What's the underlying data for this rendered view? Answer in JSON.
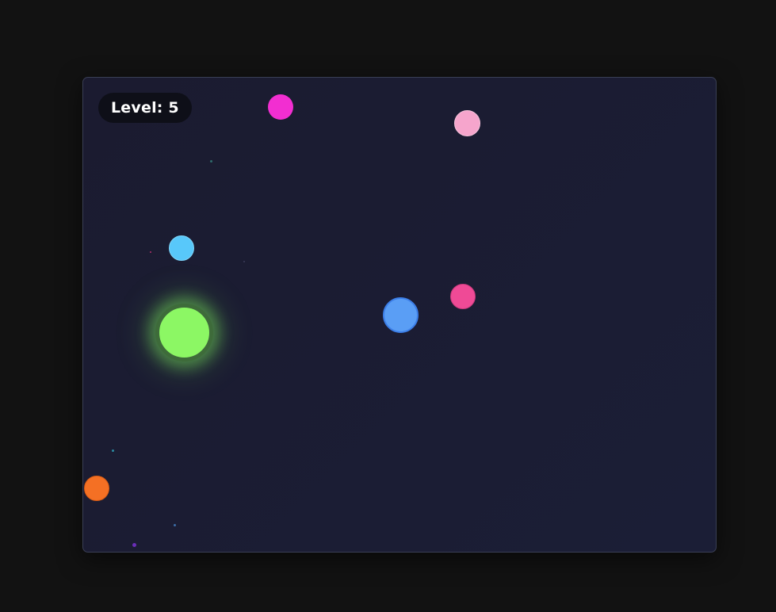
{
  "hud": {
    "level_label": "Level:",
    "level_value": "5"
  },
  "colors": {
    "page_background": "#121212",
    "playfield_background": "#1b1c33",
    "hud_background": "#0e0f18",
    "player_fill": "#8cf764",
    "player_ring": "#3e6b3a",
    "ball_magenta": "#f22ed1",
    "ball_pink_light": "#f6a5cc",
    "ball_cyan": "#58c8fa",
    "ball_blue": "#5a9ef5",
    "ball_hot_pink": "#ef4a96",
    "ball_orange": "#f47024"
  },
  "entities": {
    "player": {
      "name": "player-orb",
      "color_key": "player_fill"
    },
    "balls": [
      {
        "name": "magenta-ball",
        "color_key": "ball_magenta"
      },
      {
        "name": "light-pink-ball",
        "color_key": "ball_pink_light"
      },
      {
        "name": "cyan-ball",
        "color_key": "ball_cyan"
      },
      {
        "name": "blue-ball",
        "color_key": "ball_blue"
      },
      {
        "name": "hot-pink-ball",
        "color_key": "ball_hot_pink"
      },
      {
        "name": "orange-ball",
        "color_key": "ball_orange"
      }
    ]
  }
}
